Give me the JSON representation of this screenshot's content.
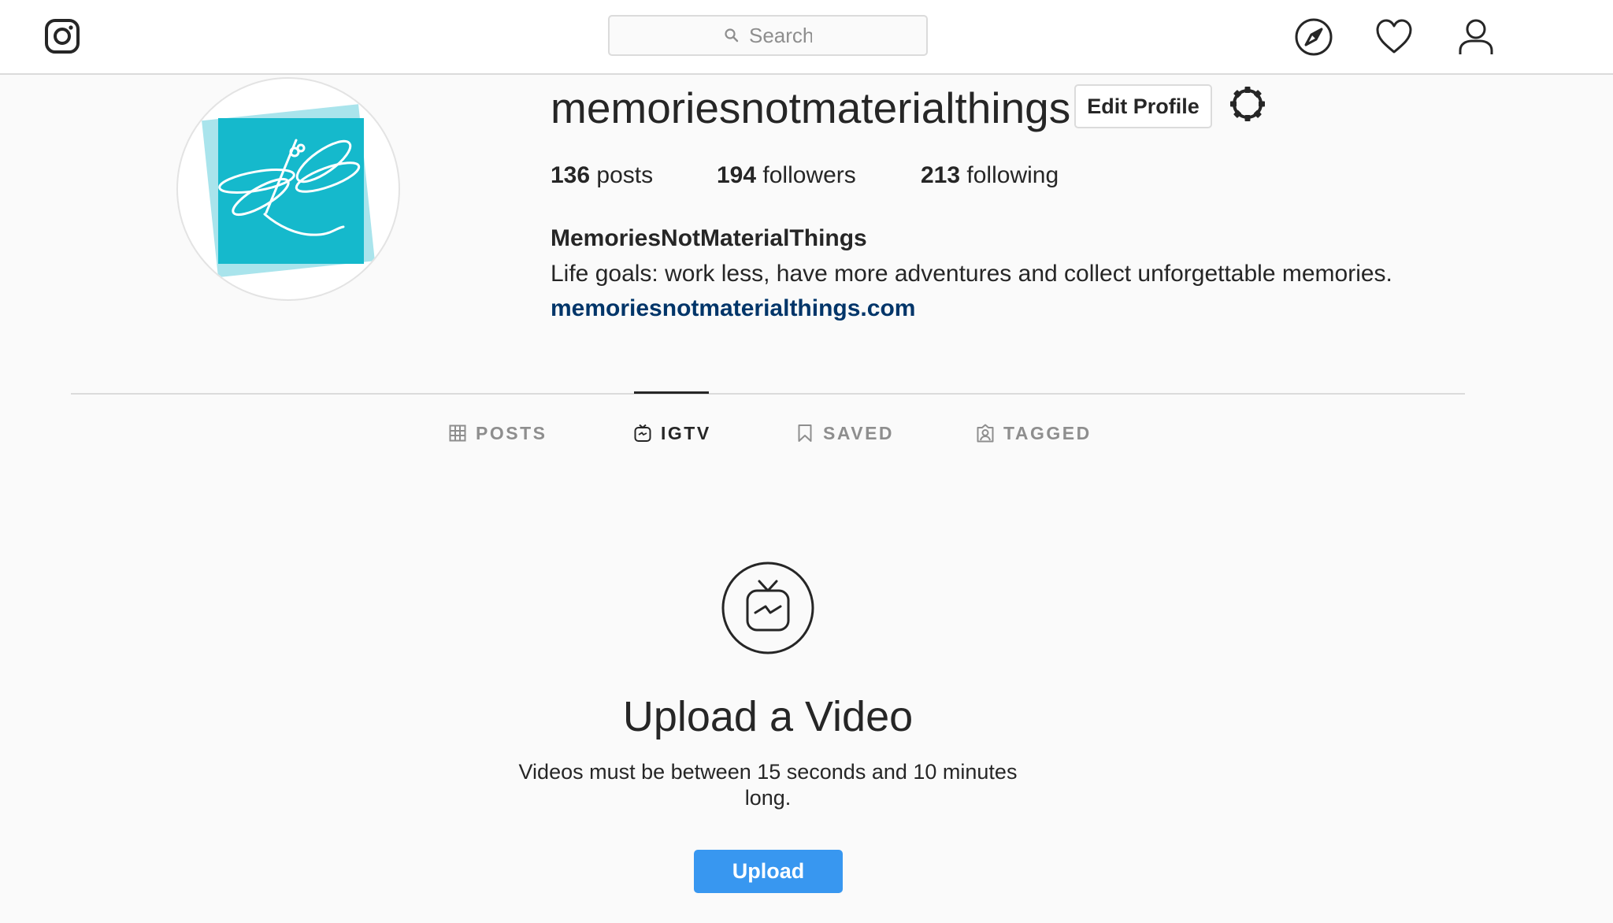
{
  "header": {
    "logo_icon": "instagram-logo-icon",
    "search": {
      "placeholder": "Search",
      "value": ""
    },
    "nav_icons": [
      "compass-explore-icon",
      "heart-activity-icon",
      "user-profile-icon"
    ]
  },
  "profile": {
    "username": "memoriesnotmaterialthings",
    "edit_profile_label": "Edit Profile",
    "settings_icon": "gear-icon",
    "avatar_icon": "dragonfly-logo",
    "avatar_colors": {
      "main": "#15b9cc",
      "back": "#a9e4ec"
    },
    "stats": {
      "posts_count": "136",
      "posts_label": "posts",
      "followers_count": "194",
      "followers_label": "followers",
      "following_count": "213",
      "following_label": "following"
    },
    "full_name": "MemoriesNotMaterialThings",
    "bio": "Life goals: work less, have more adventures and collect unforgettable memories.",
    "website": "memoriesnotmaterialthings.com"
  },
  "tabs": [
    {
      "label": "POSTS",
      "icon": "grid-icon",
      "active": false
    },
    {
      "label": "IGTV",
      "icon": "igtv-icon",
      "active": true
    },
    {
      "label": "SAVED",
      "icon": "bookmark-icon",
      "active": false
    },
    {
      "label": "TAGGED",
      "icon": "tagged-person-icon",
      "active": false
    }
  ],
  "empty_state": {
    "icon": "igtv-icon",
    "title": "Upload a Video",
    "text": "Videos must be between 15 seconds and 10 minutes long.",
    "button_label": "Upload"
  },
  "colors": {
    "accent": "#3897f0",
    "link": "#003569",
    "text": "#262626",
    "muted": "#8e8e8e",
    "border": "#dbdbdb",
    "background": "#fafafa"
  }
}
